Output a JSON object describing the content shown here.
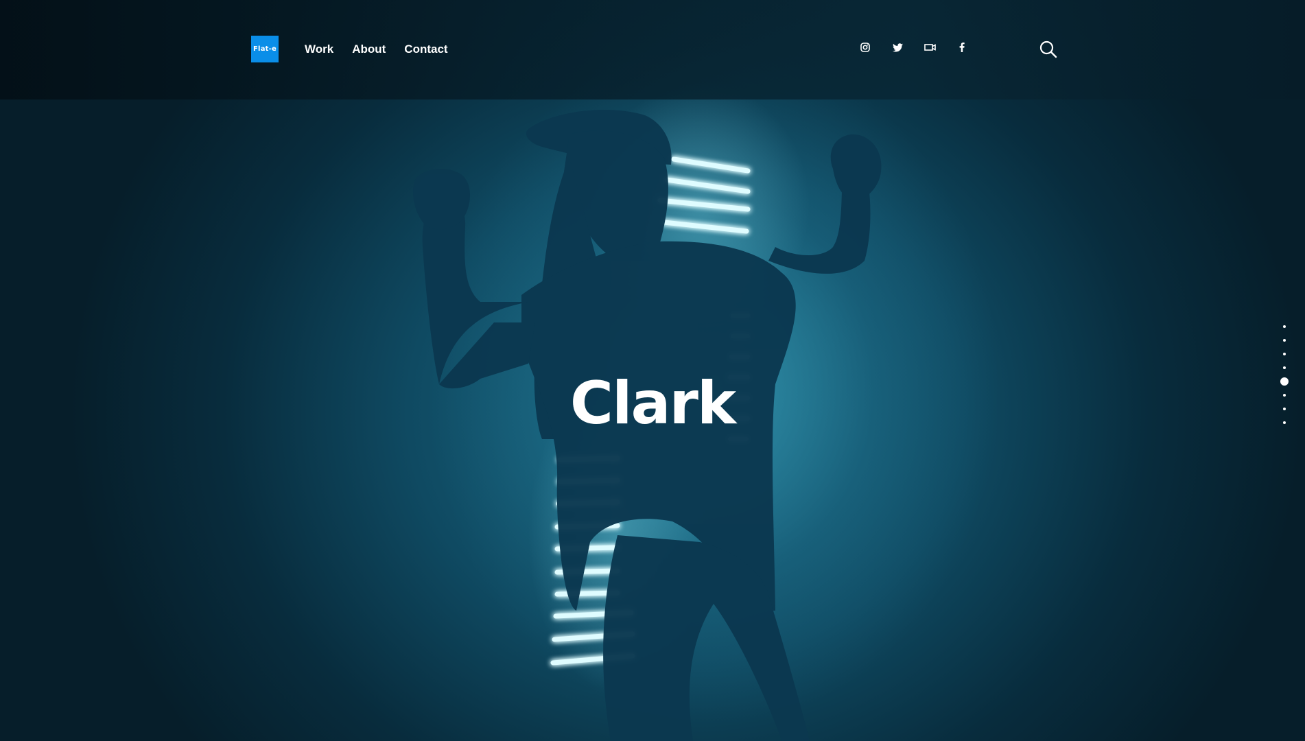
{
  "header": {
    "logo_text": "Flat-e",
    "nav": [
      {
        "label": "Work"
      },
      {
        "label": "About"
      },
      {
        "label": "Contact"
      }
    ],
    "social_icons": [
      "instagram-icon",
      "twitter-icon",
      "video-icon",
      "facebook-icon"
    ],
    "search_icon": "search-icon"
  },
  "hero": {
    "title": "Clark"
  },
  "pager": {
    "total": 8,
    "active_index": 4
  },
  "colors": {
    "accent": "#0a8ee8",
    "text": "#ffffff",
    "neon": "#bff6ff"
  }
}
